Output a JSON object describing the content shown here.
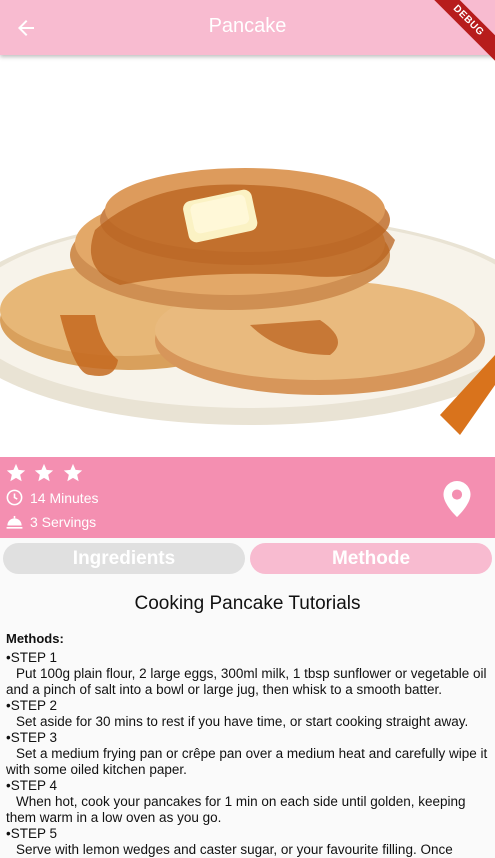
{
  "appbar": {
    "title": "Pancake",
    "back_icon": "arrow-back-icon",
    "debug_label": "DEBUG"
  },
  "hero": {
    "image": "pancake-stack-photo"
  },
  "info": {
    "rating": 3,
    "time": "14 Minutes",
    "servings": "3 Servings",
    "icons": [
      "star-icon",
      "clock-icon",
      "cloche-icon",
      "location-pin-icon"
    ]
  },
  "tabs": {
    "ingredients": "Ingredients",
    "method": "Methode"
  },
  "content": {
    "heading": "Cooking Pancake Tutorials",
    "methods_label": "Methods:",
    "steps": [
      {
        "title": "•STEP 1",
        "text": "Put 100g plain flour, 2 large eggs, 300ml milk, 1 tbsp sunflower or vegetable oil and a pinch of salt into a bowl or large jug, then whisk to a smooth batter."
      },
      {
        "title": "•STEP 2",
        "text": "Set aside for 30 mins to rest if you have time, or start cooking straight away."
      },
      {
        "title": "•STEP 3",
        "text": "Set a medium frying pan or crêpe pan over a medium heat and carefully wipe it with some oiled kitchen paper."
      },
      {
        "title": "•STEP 4",
        "text": "When hot, cook your pancakes for 1 min on each side until golden, keeping them warm in a low oven as you go."
      },
      {
        "title": "•STEP 5",
        "text": "Serve with lemon wedges and caster sugar, or your favourite filling. Once"
      }
    ]
  },
  "colors": {
    "appbar": "#f8bbd0",
    "infobar": "#f48fb1",
    "tab_inactive": "#e0e0e0",
    "tab_active": "#f8bbd0",
    "debug": "#b71c1c"
  }
}
